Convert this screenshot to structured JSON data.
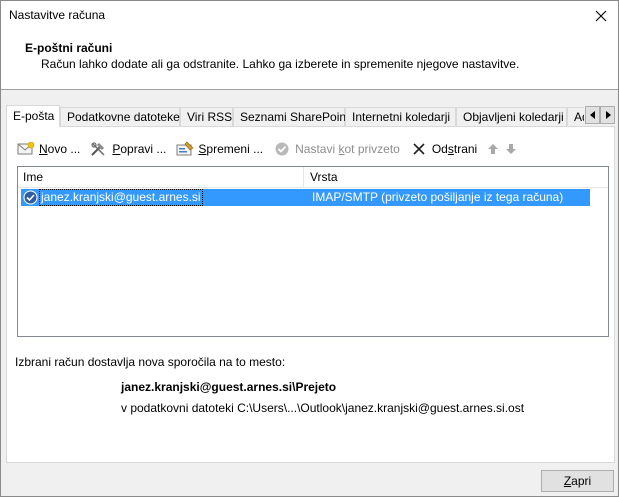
{
  "window": {
    "title": "Nastavitve računa"
  },
  "header": {
    "title": "E-poštni računi",
    "description": "Račun lahko dodate ali ga odstranite. Lahko ga izberete in spremenite njegove nastavitve."
  },
  "tabs": [
    {
      "label": "E-pošta",
      "active": true
    },
    {
      "label": "Podatkovne datoteke"
    },
    {
      "label": "Viri RSS"
    },
    {
      "label": "Seznami SharePoint"
    },
    {
      "label": "Internetni koledarji"
    },
    {
      "label": "Objavljeni koledarji"
    },
    {
      "label": "Ad"
    }
  ],
  "toolbar": {
    "new_u": "N",
    "new_rest": "ovo ...",
    "repair_u": "P",
    "repair_rest": "opravi ...",
    "change_u": "S",
    "change_rest": "premeni ...",
    "default_pre": "Nastavi ",
    "default_u": "k",
    "default_rest": "ot privzeto",
    "remove_pre": "Od",
    "remove_u": "s",
    "remove_rest": "trani"
  },
  "list": {
    "col_name": "Ime",
    "col_type": "Vrsta",
    "rows": [
      {
        "name": "janez.kranjski@guest.arnes.si",
        "type": "IMAP/SMTP (privzeto pošiljanje iz tega računa)"
      }
    ]
  },
  "info": {
    "label": "Izbrani račun dostavlja nova sporočila na to mesto:",
    "path": "janez.kranjski@guest.arnes.si\\Prejeto",
    "file": "v podatkovni datoteki C:\\Users\\...\\Outlook\\janez.kranjski@guest.arnes.si.ost"
  },
  "footer": {
    "close_u": "Z",
    "close_rest": "apri"
  }
}
